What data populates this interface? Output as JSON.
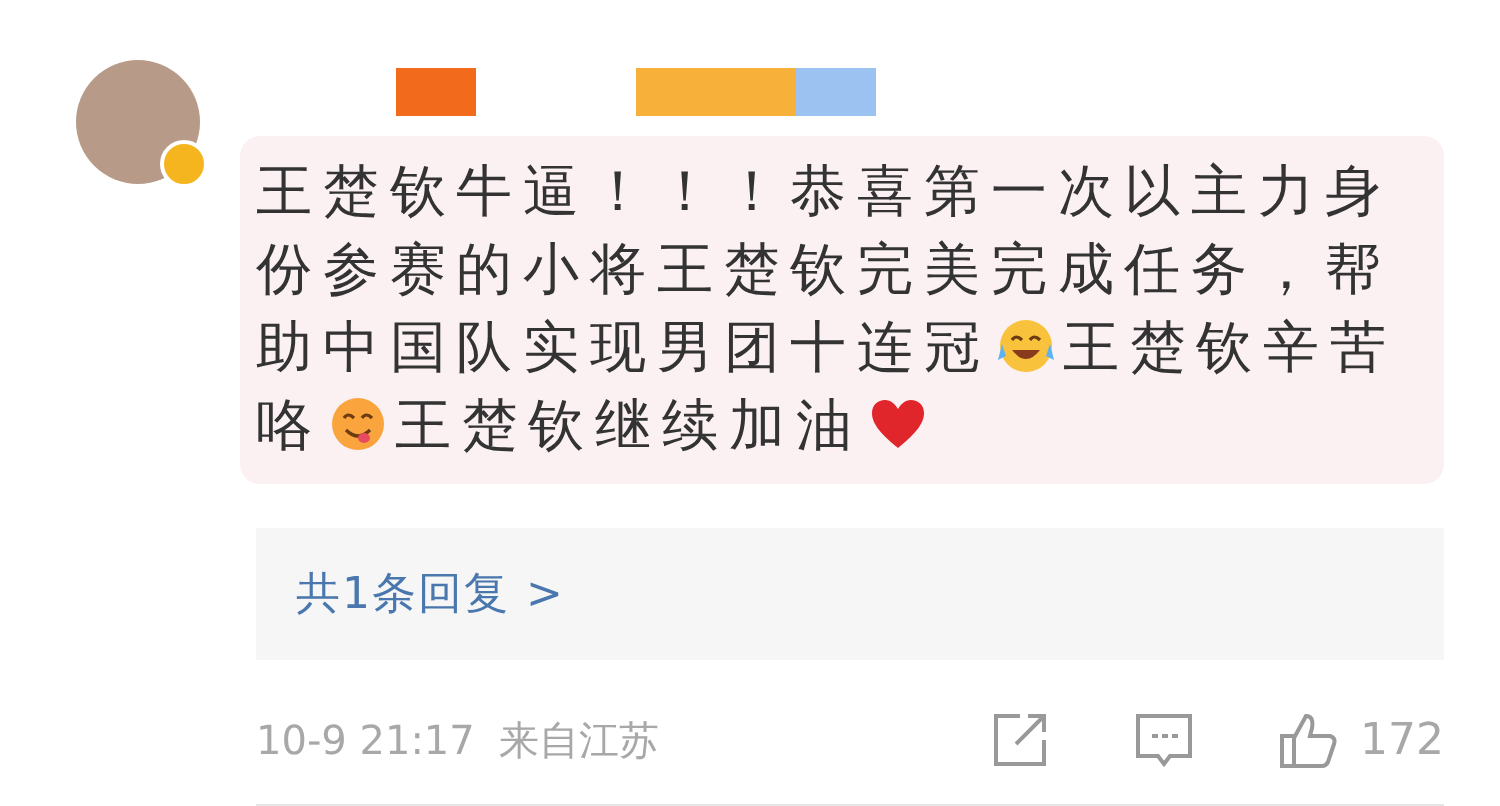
{
  "comment": {
    "lines": [
      [
        {
          "kind": "text",
          "text": "王楚钦牛逼！！！恭喜第一次以主力身"
        }
      ],
      [
        {
          "kind": "text",
          "text": "份参赛的小将王楚钦完美完成任务，帮"
        }
      ],
      [
        {
          "kind": "text",
          "text": "助中国队实现男团十连冠"
        },
        {
          "kind": "emoji-tears"
        },
        {
          "kind": "text",
          "text": "王楚钦辛苦"
        }
      ],
      [
        {
          "kind": "text",
          "text": "咯"
        },
        {
          "kind": "emoji-yum"
        },
        {
          "kind": "text",
          "text": "王楚钦继续加油"
        },
        {
          "kind": "emoji-heart"
        }
      ]
    ],
    "replies_link": "共1条回复 >",
    "time": "10-9 21:17",
    "location": "来自江苏",
    "likes": "172"
  }
}
